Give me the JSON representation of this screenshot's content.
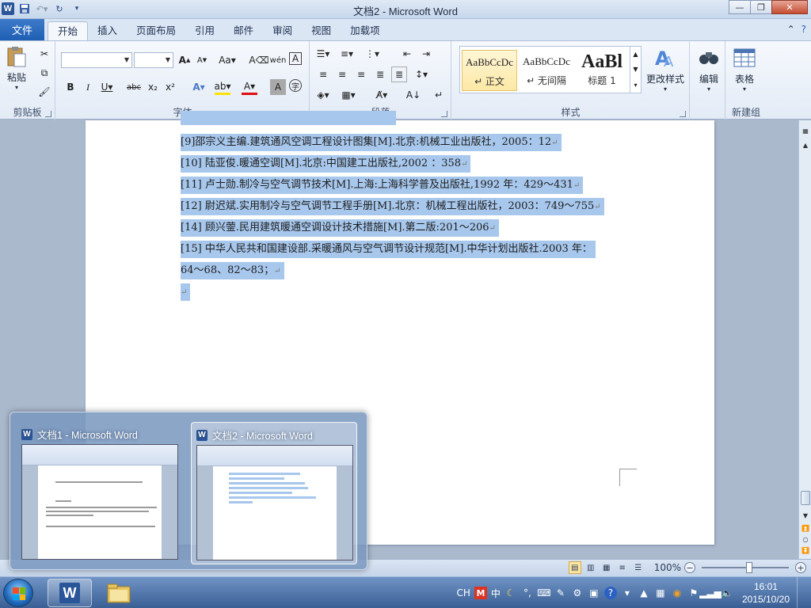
{
  "window": {
    "title": "文档2 - Microsoft Word",
    "app_icon": "W"
  },
  "ribbon": {
    "file_tab": "文件",
    "tabs": [
      "开始",
      "插入",
      "页面布局",
      "引用",
      "邮件",
      "审阅",
      "视图",
      "加载项"
    ],
    "groups": {
      "clipboard": {
        "label": "剪贴板",
        "paste": "粘贴"
      },
      "font": {
        "label": "字体",
        "font_name": "",
        "font_size": ""
      },
      "paragraph": {
        "label": "段落"
      },
      "styles": {
        "label": "样式",
        "items": [
          {
            "preview": "AaBbCcDc",
            "name": "↵ 正文"
          },
          {
            "preview": "AaBbCcDc",
            "name": "↵ 无间隔"
          },
          {
            "preview": "AaBl",
            "name": "标题 1"
          }
        ],
        "change_styles": "更改样式"
      },
      "editing": {
        "label": "编辑"
      },
      "newgroup": {
        "label": "新建组",
        "table": "表格"
      }
    }
  },
  "document": {
    "lines": [
      "[9]邵宗义主编.建筑通风空调工程设计图集[M].北京:机械工业出版社，2005：12",
      "[10]  陆亚俊.暖通空调[M].北京:中国建工出版社,2002 ：358",
      "[11]  卢士勋.制冷与空气调节技术[M].上海:上海科学普及出版社,1992 年：429～431",
      "[12]  尉迟斌.实用制冷与空气调节工程手册[M].北京：机械工程出版社，2003：749～755",
      "[14]  顾兴蓥.民用建筑暖通空调设计技术措施[M].第二版:201～206",
      "[15]   中华人民共和国建设部.采暖通风与空气调节设计规范[M].中华计划出版社.2003  年：",
      "64～68、82～83；",
      ""
    ],
    "paragraph_mark": "↵"
  },
  "statusbar": {
    "zoom": "100%"
  },
  "taskbar_preview": {
    "windows": [
      {
        "title": "文档1 - Microsoft Word",
        "active": false
      },
      {
        "title": "文档2 - Microsoft Word",
        "active": true
      }
    ]
  },
  "tray": {
    "lang": "CH",
    "ime": "中",
    "time": "16:01",
    "date": "2015/10/20"
  }
}
